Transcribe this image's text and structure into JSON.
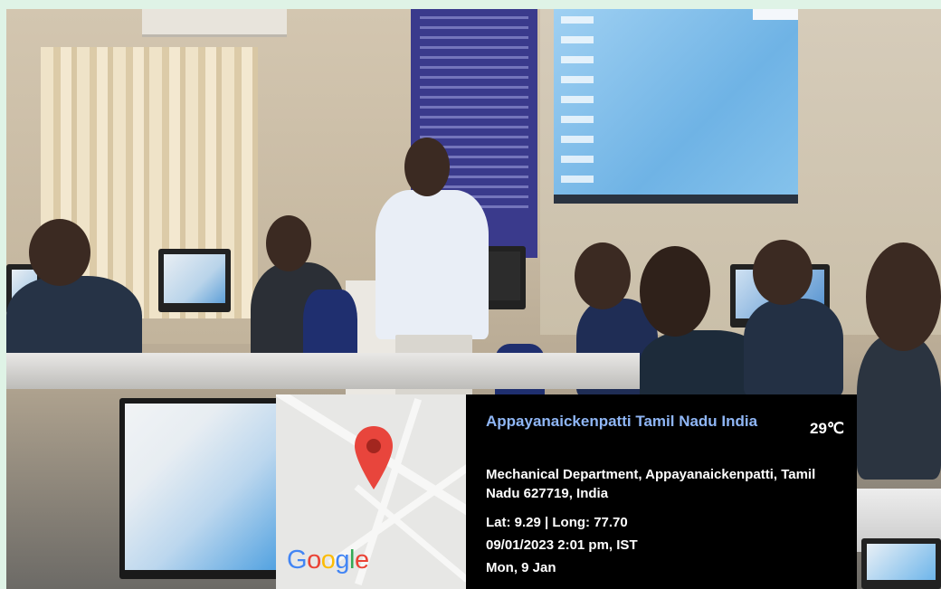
{
  "overlay": {
    "place_title": "Appayanaickenpatti Tamil Nadu India",
    "temperature": "29℃",
    "address": "Mechanical Department, Appayanaickenpatti, Tamil Nadu 627719, India",
    "coordinates": "Lat: 9.29 | Long: 77.70",
    "datetime": "09/01/2023  2:01 pm, IST",
    "day": "Mon, 9 Jan"
  },
  "map": {
    "logo_text": [
      "G",
      "o",
      "o",
      "g",
      "l",
      "e"
    ],
    "logo_colors": [
      "#4285f4",
      "#ea4335",
      "#fbbc05",
      "#4285f4",
      "#34a853",
      "#ea4335"
    ],
    "pin_color": "#e8453c",
    "pin_icon": "map-pin-icon"
  },
  "colors": {
    "place_title": "#8fb6f5",
    "info_background": "#000000",
    "frame": "#dff3e6"
  }
}
